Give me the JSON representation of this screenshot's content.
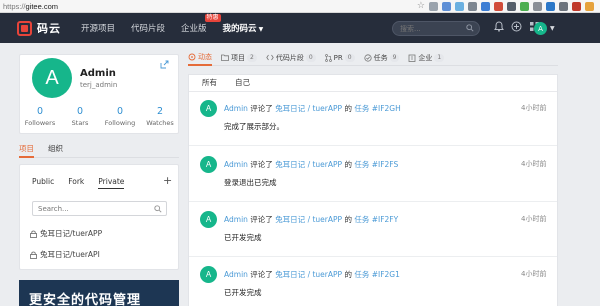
{
  "browser": {
    "url_scheme": "https://",
    "url_host": "gitee.com"
  },
  "nav": {
    "logo_text": "码云",
    "links": [
      {
        "label": "开源项目"
      },
      {
        "label": "代码片段"
      },
      {
        "label": "企业版",
        "badge": "特惠"
      },
      {
        "label": "我的码云"
      }
    ],
    "search_placeholder": "搜索...",
    "avatar_letter": "A"
  },
  "profile": {
    "avatar_letter": "A",
    "name": "Admin",
    "login": "terj_admin",
    "stats": [
      {
        "value": "0",
        "label": "Followers"
      },
      {
        "value": "0",
        "label": "Stars"
      },
      {
        "value": "0",
        "label": "Following"
      },
      {
        "value": "2",
        "label": "Watches"
      }
    ]
  },
  "left_tabs": [
    {
      "label": "项目"
    },
    {
      "label": "组织"
    }
  ],
  "repo_panel": {
    "filters": [
      {
        "label": "Public"
      },
      {
        "label": "Fork"
      },
      {
        "label": "Private"
      }
    ],
    "search_placeholder": "Search...",
    "repos": [
      {
        "name": "兔耳日记/tuerAPP"
      },
      {
        "name": "兔耳日记/tuerAPI"
      }
    ]
  },
  "banner": {
    "text": "更安全的代码管理"
  },
  "right_tabs": [
    {
      "label": "动态",
      "count": ""
    },
    {
      "label": "项目",
      "count": "2"
    },
    {
      "label": "代码片段",
      "count": "0"
    },
    {
      "label": "PR",
      "count": "0"
    },
    {
      "label": "任务",
      "count": "9"
    },
    {
      "label": "企业",
      "count": "1"
    }
  ],
  "feed": {
    "subtabs": [
      {
        "label": "所有"
      },
      {
        "label": "自己"
      }
    ],
    "items": [
      {
        "avatar": "A",
        "user": "Admin",
        "action": " 评论了 ",
        "project": "兔耳日记 / tuerAPP",
        "of": " 的 ",
        "target": "任务 #IF2GH",
        "time": "4小时前",
        "body": "完成了展示部分。"
      },
      {
        "avatar": "A",
        "user": "Admin",
        "action": " 评论了 ",
        "project": "兔耳日记 / tuerAPP",
        "of": " 的 ",
        "target": "任务 #IF2FS",
        "time": "4小时前",
        "body": "登录退出已完成"
      },
      {
        "avatar": "A",
        "user": "Admin",
        "action": " 评论了 ",
        "project": "兔耳日记 / tuerAPP",
        "of": " 的 ",
        "target": "任务 #IF2FY",
        "time": "4小时前",
        "body": "已开发完成"
      },
      {
        "avatar": "A",
        "user": "Admin",
        "action": " 评论了 ",
        "project": "兔耳日记 / tuerAPP",
        "of": " 的 ",
        "target": "任务 #IF2G1",
        "time": "4小时前",
        "body": "已开发完成"
      }
    ]
  },
  "colors": {
    "accent": "#e56c3a",
    "link": "#4b9ad6",
    "avatar": "#16b68b",
    "nav_bg": "#262d3b",
    "brand_red": "#e7443a"
  }
}
